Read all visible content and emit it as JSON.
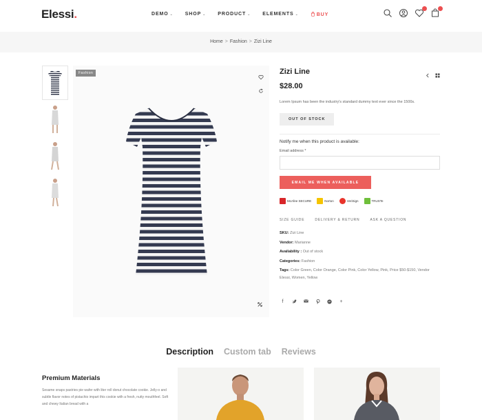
{
  "header": {
    "logo": "Elessi",
    "logo_dot": ".",
    "nav": [
      {
        "label": "DEMO"
      },
      {
        "label": "SHOP"
      },
      {
        "label": "PRODUCT"
      },
      {
        "label": "ELEMENTS"
      },
      {
        "label": "BUY"
      }
    ],
    "icons": [
      "search-icon",
      "account-icon",
      "wishlist-icon",
      "cart-icon"
    ],
    "accent": "#ec4f50"
  },
  "breadcrumb": {
    "items": [
      "Home",
      "Fashion",
      "Zizi Line"
    ],
    "separator": ">"
  },
  "gallery": {
    "badge": "Fashion",
    "thumbnail_count": 4
  },
  "product": {
    "title": "Zizi Line",
    "price": "$28.00",
    "description": "Lorem Ipsum has been the industry's standard dummy text ever since the 1500s.",
    "stock_button": "OUT OF STOCK",
    "notify_text": "Notify me when this product is available:",
    "email_label": "Email address *",
    "email_value": "",
    "notify_button": "EMAIL ME WHEN AVAILABLE",
    "trust_badges": [
      {
        "label": "McAfee SECURE",
        "color": "#d8262a"
      },
      {
        "label": "Norton",
        "color": "#f5c400"
      },
      {
        "label": "VeriSign",
        "color": "#e8342b"
      },
      {
        "label": "TRUSTe",
        "color": "#6fbf3b"
      }
    ],
    "links": [
      "SIZE GUIDE",
      "DELIVERY & RETURN",
      "ASK A QUESTION"
    ],
    "meta": {
      "sku_label": "SKU:",
      "sku": "Zizi Line",
      "vendor_label": "Vendor:",
      "vendor": "Marianne",
      "availability_label": "Availability :",
      "availability": "Out of stock",
      "categories_label": "Categories:",
      "categories": "Fashion",
      "tags_label": "Tags:",
      "tags": "Color Green, Color Orange, Color Pink, Color Yellow, Pink, Price $50-$150, Vendor Elessi, Women, Yellow"
    },
    "share_icons": [
      "facebook-icon",
      "twitter-icon",
      "email-icon",
      "pinterest-icon",
      "messenger-icon",
      "plus-icon"
    ]
  },
  "tabs": [
    {
      "label": "Description"
    },
    {
      "label": "Custom tab"
    },
    {
      "label": "Reviews"
    }
  ],
  "description_section": {
    "heading": "Premium Materials",
    "text": "Sesame snaps pastries pie wafer with liter roll donut chocolate cookie. Jelly-o and subtle flavor notes of pistachio impart this cookie with a fresh, nutty mouthfeel. Soft and chewy Italian bread with a"
  }
}
